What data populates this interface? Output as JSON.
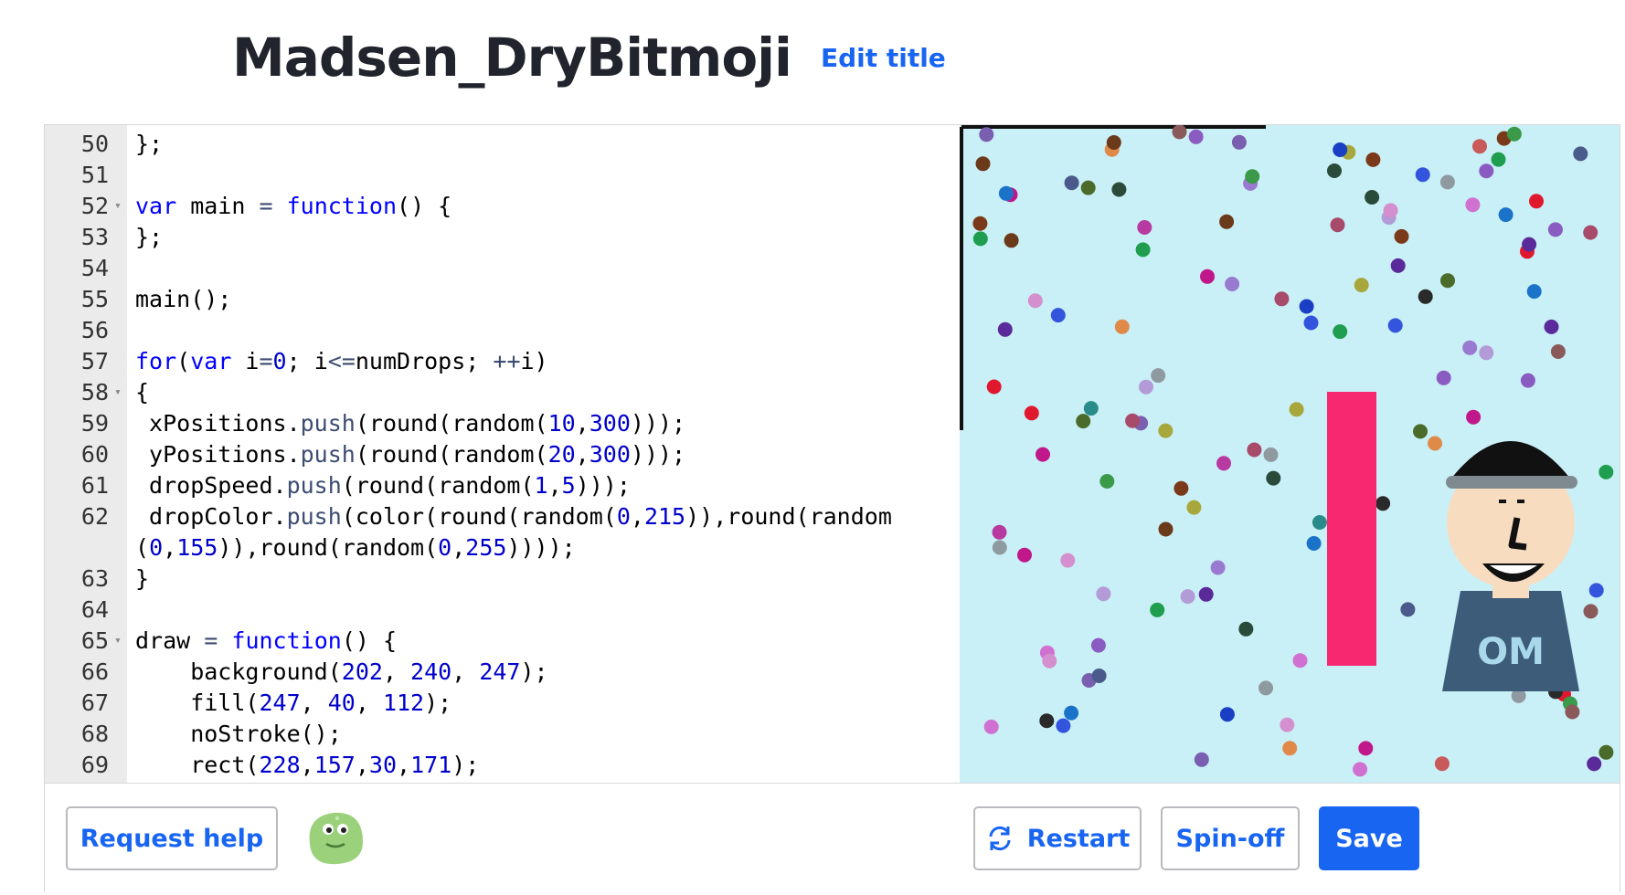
{
  "page": {
    "title": "Madsen_DryBitmoji",
    "edit_title_label": "Edit title"
  },
  "editor": {
    "lines": [
      {
        "n": "50",
        "fold": false,
        "tokens": [
          [
            "plain",
            "};"
          ]
        ]
      },
      {
        "n": "51",
        "fold": false,
        "tokens": []
      },
      {
        "n": "52",
        "fold": true,
        "tokens": [
          [
            "kw",
            "var"
          ],
          [
            "plain",
            " main "
          ],
          [
            "fn",
            "="
          ],
          [
            "plain",
            " "
          ],
          [
            "kw",
            "function"
          ],
          [
            "plain",
            "() {"
          ]
        ]
      },
      {
        "n": "53",
        "fold": false,
        "tokens": [
          [
            "plain",
            "};"
          ]
        ]
      },
      {
        "n": "54",
        "fold": false,
        "tokens": []
      },
      {
        "n": "55",
        "fold": false,
        "tokens": [
          [
            "plain",
            "main();"
          ]
        ]
      },
      {
        "n": "56",
        "fold": false,
        "tokens": []
      },
      {
        "n": "57",
        "fold": false,
        "tokens": [
          [
            "kw",
            "for"
          ],
          [
            "plain",
            "("
          ],
          [
            "kw",
            "var"
          ],
          [
            "plain",
            " i"
          ],
          [
            "fn",
            "="
          ],
          [
            "num",
            "0"
          ],
          [
            "plain",
            "; i"
          ],
          [
            "fn",
            "<="
          ],
          [
            "plain",
            "numDrops; "
          ],
          [
            "fn",
            "++"
          ],
          [
            "plain",
            "i)"
          ]
        ]
      },
      {
        "n": "58",
        "fold": true,
        "tokens": [
          [
            "plain",
            "{"
          ]
        ]
      },
      {
        "n": "59",
        "fold": false,
        "tokens": [
          [
            "plain",
            " xPositions."
          ],
          [
            "fn",
            "push"
          ],
          [
            "plain",
            "(round(random("
          ],
          [
            "num",
            "10"
          ],
          [
            "plain",
            ","
          ],
          [
            "num",
            "300"
          ],
          [
            "plain",
            ")));"
          ]
        ]
      },
      {
        "n": "60",
        "fold": false,
        "tokens": [
          [
            "plain",
            " yPositions."
          ],
          [
            "fn",
            "push"
          ],
          [
            "plain",
            "(round(random("
          ],
          [
            "num",
            "20"
          ],
          [
            "plain",
            ","
          ],
          [
            "num",
            "300"
          ],
          [
            "plain",
            ")));"
          ]
        ]
      },
      {
        "n": "61",
        "fold": false,
        "tokens": [
          [
            "plain",
            " dropSpeed."
          ],
          [
            "fn",
            "push"
          ],
          [
            "plain",
            "(round(random("
          ],
          [
            "num",
            "1"
          ],
          [
            "plain",
            ","
          ],
          [
            "num",
            "5"
          ],
          [
            "plain",
            ")));"
          ]
        ]
      },
      {
        "n": "62",
        "fold": false,
        "tokens": [
          [
            "plain",
            " dropColor."
          ],
          [
            "fn",
            "push"
          ],
          [
            "plain",
            "(color(round(random("
          ],
          [
            "num",
            "0"
          ],
          [
            "plain",
            ","
          ],
          [
            "num",
            "215"
          ],
          [
            "plain",
            ")),round(random"
          ]
        ]
      },
      {
        "n": "",
        "fold": false,
        "tokens": [
          [
            "plain",
            "("
          ],
          [
            "num",
            "0"
          ],
          [
            "plain",
            ","
          ],
          [
            "num",
            "155"
          ],
          [
            "plain",
            ")),round(random("
          ],
          [
            "num",
            "0"
          ],
          [
            "plain",
            ","
          ],
          [
            "num",
            "255"
          ],
          [
            "plain",
            "))));"
          ]
        ]
      },
      {
        "n": "63",
        "fold": false,
        "tokens": [
          [
            "plain",
            "}"
          ]
        ]
      },
      {
        "n": "64",
        "fold": false,
        "tokens": []
      },
      {
        "n": "65",
        "fold": true,
        "tokens": [
          [
            "plain",
            "draw "
          ],
          [
            "fn",
            "="
          ],
          [
            "plain",
            " "
          ],
          [
            "kw",
            "function"
          ],
          [
            "plain",
            "() {"
          ]
        ]
      },
      {
        "n": "66",
        "fold": false,
        "tokens": [
          [
            "plain",
            "    background("
          ],
          [
            "num",
            "202"
          ],
          [
            "plain",
            ", "
          ],
          [
            "num",
            "240"
          ],
          [
            "plain",
            ", "
          ],
          [
            "num",
            "247"
          ],
          [
            "plain",
            ");"
          ]
        ]
      },
      {
        "n": "67",
        "fold": false,
        "tokens": [
          [
            "plain",
            "    fill("
          ],
          [
            "num",
            "247"
          ],
          [
            "plain",
            ", "
          ],
          [
            "num",
            "40"
          ],
          [
            "plain",
            ", "
          ],
          [
            "num",
            "112"
          ],
          [
            "plain",
            ");"
          ]
        ]
      },
      {
        "n": "68",
        "fold": false,
        "tokens": [
          [
            "plain",
            "    noStroke();"
          ]
        ]
      },
      {
        "n": "69",
        "fold": false,
        "tokens": [
          [
            "plain",
            "    rect("
          ],
          [
            "num",
            "228"
          ],
          [
            "plain",
            ","
          ],
          [
            "num",
            "157"
          ],
          [
            "plain",
            ","
          ],
          [
            "num",
            "30"
          ],
          [
            "plain",
            ","
          ],
          [
            "num",
            "171"
          ],
          [
            "plain",
            ");"
          ]
        ]
      }
    ]
  },
  "canvas": {
    "background": "#caf0f7",
    "bar_color": "#f72870",
    "shirt_text": "OM",
    "drop_colors": [
      "#d48fcf",
      "#c0188a",
      "#1e9e4e",
      "#8e9aa0",
      "#4a6b2a",
      "#3355dd",
      "#8a5bc0",
      "#b29bd6",
      "#5b2a9a",
      "#7a3a1a",
      "#1a73c9",
      "#a7a73b",
      "#6b3a1a",
      "#7a5fb0",
      "#2a4a3a",
      "#e0182e",
      "#c85a5a",
      "#2a8c8a",
      "#b83aa0",
      "#e08a4a",
      "#3a9a4a",
      "#1a3fc4",
      "#d070d0",
      "#a84a6a",
      "#4a5a8a",
      "#2a2a2a",
      "#8a5a5a",
      "#9a7ad0"
    ]
  },
  "footer": {
    "request_help_label": "Request help",
    "restart_label": "Restart",
    "spinoff_label": "Spin-off",
    "save_label": "Save"
  }
}
